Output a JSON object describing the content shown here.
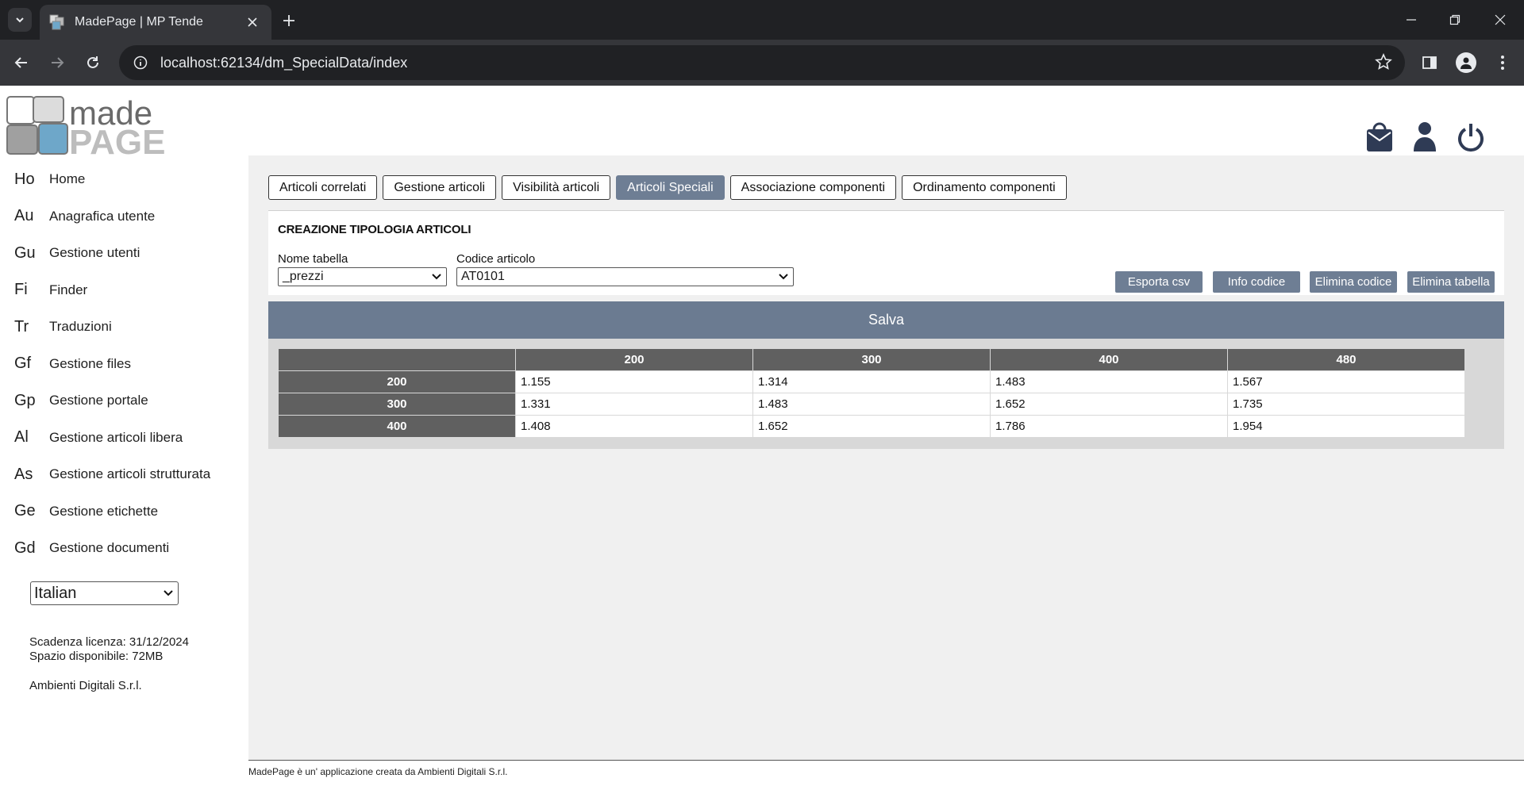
{
  "browser": {
    "tab_title": "MadePage | MP Tende",
    "url": "localhost:62134/dm_SpecialData/index"
  },
  "sidebar": {
    "items": [
      {
        "abbr": "Ho",
        "label": "Home"
      },
      {
        "abbr": "Au",
        "label": "Anagrafica utente"
      },
      {
        "abbr": "Gu",
        "label": "Gestione utenti"
      },
      {
        "abbr": "Fi",
        "label": "Finder"
      },
      {
        "abbr": "Tr",
        "label": "Traduzioni"
      },
      {
        "abbr": "Gf",
        "label": "Gestione files"
      },
      {
        "abbr": "Gp",
        "label": "Gestione portale"
      },
      {
        "abbr": "Al",
        "label": "Gestione articoli libera"
      },
      {
        "abbr": "As",
        "label": "Gestione articoli strutturata"
      },
      {
        "abbr": "Ge",
        "label": "Gestione etichette"
      },
      {
        "abbr": "Gd",
        "label": "Gestione documenti"
      }
    ],
    "language": "Italian",
    "license": "Scadenza licenza: 31/12/2024",
    "space": "Spazio disponibile: 72MB",
    "company": "Ambienti Digitali S.r.l."
  },
  "tabs": [
    {
      "label": "Articoli correlati",
      "active": false
    },
    {
      "label": "Gestione articoli",
      "active": false
    },
    {
      "label": "Visibilità articoli",
      "active": false
    },
    {
      "label": "Articoli Speciali",
      "active": true
    },
    {
      "label": "Associazione componenti",
      "active": false
    },
    {
      "label": "Ordinamento componenti",
      "active": false
    }
  ],
  "form": {
    "title": "CREAZIONE TIPOLOGIA ARTICOLI",
    "table_label": "Nome tabella",
    "table_value": "_prezzi",
    "code_label": "Codice articolo",
    "code_value": "AT0101",
    "buttons": {
      "export": "Esporta csv",
      "info": "Info codice",
      "delete_code": "Elimina codice",
      "delete_table": "Elimina tabella"
    },
    "save": "Salva"
  },
  "grid": {
    "columns": [
      "200",
      "300",
      "400",
      "480"
    ],
    "rows": [
      {
        "header": "200",
        "cells": [
          "1.155",
          "1.314",
          "1.483",
          "1.567"
        ]
      },
      {
        "header": "300",
        "cells": [
          "1.331",
          "1.483",
          "1.652",
          "1.735"
        ]
      },
      {
        "header": "400",
        "cells": [
          "1.408",
          "1.652",
          "1.786",
          "1.954"
        ]
      }
    ]
  },
  "footer": "MadePage è un' applicazione creata da Ambienti Digitali S.r.l.",
  "colors": {
    "accent": "#6e7e94",
    "grid_header": "#606060",
    "icon": "#2f3b55"
  }
}
